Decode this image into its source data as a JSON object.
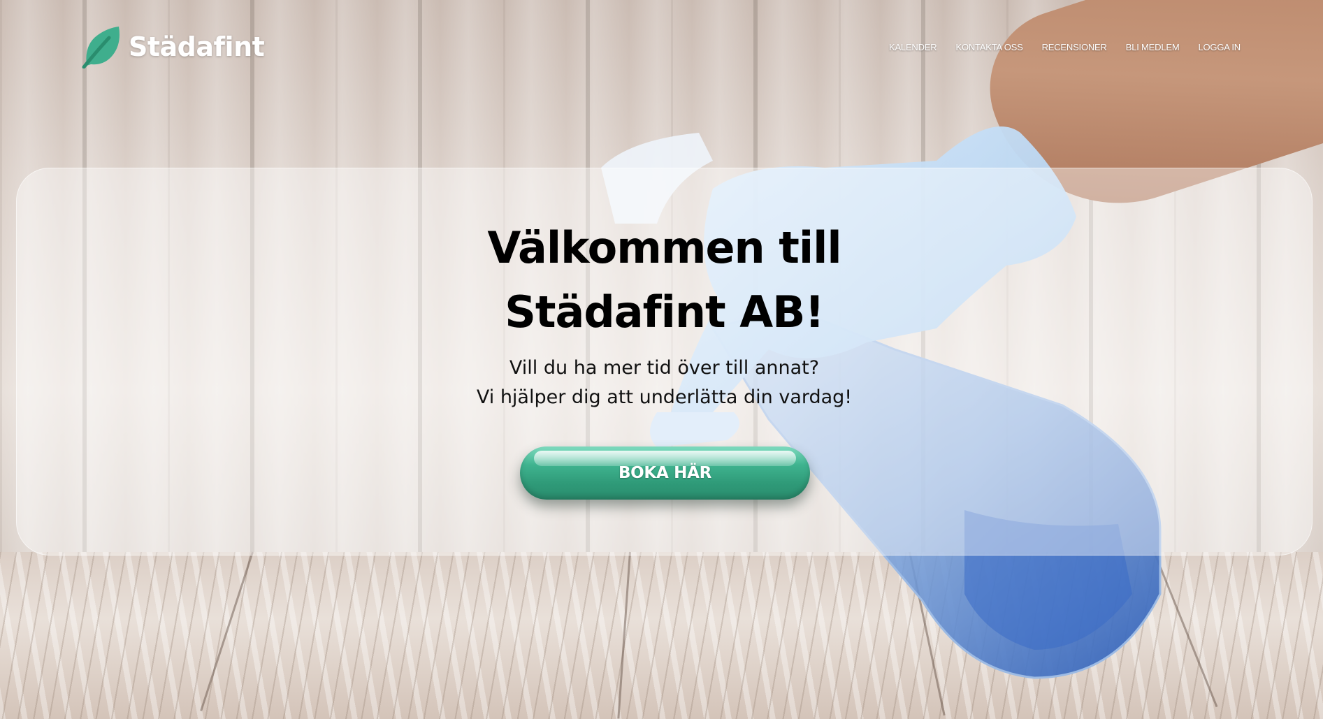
{
  "header": {
    "brand": "Städafint",
    "nav": [
      {
        "label": "KALENDER"
      },
      {
        "label": "KONTAKTA OSS"
      },
      {
        "label": "RECENSIONER"
      },
      {
        "label": "BLI MEDLEM"
      },
      {
        "label": "LOGGA IN"
      }
    ]
  },
  "hero": {
    "title_line1": "Välkommen till",
    "title_line2": "Städafint AB!",
    "subtitle_line1": "Vill du ha mer tid över till annat?",
    "subtitle_line2": "Vi hjälper dig att underlätta din vardag!",
    "cta_label": "BOKA HÄR"
  },
  "colors": {
    "brand_green": "#2f9a78",
    "logo_leaf": "#3fae8d",
    "title_text": "#000000",
    "nav_text": "#ffffff"
  },
  "icons": {
    "logo": "leaf-icon"
  }
}
